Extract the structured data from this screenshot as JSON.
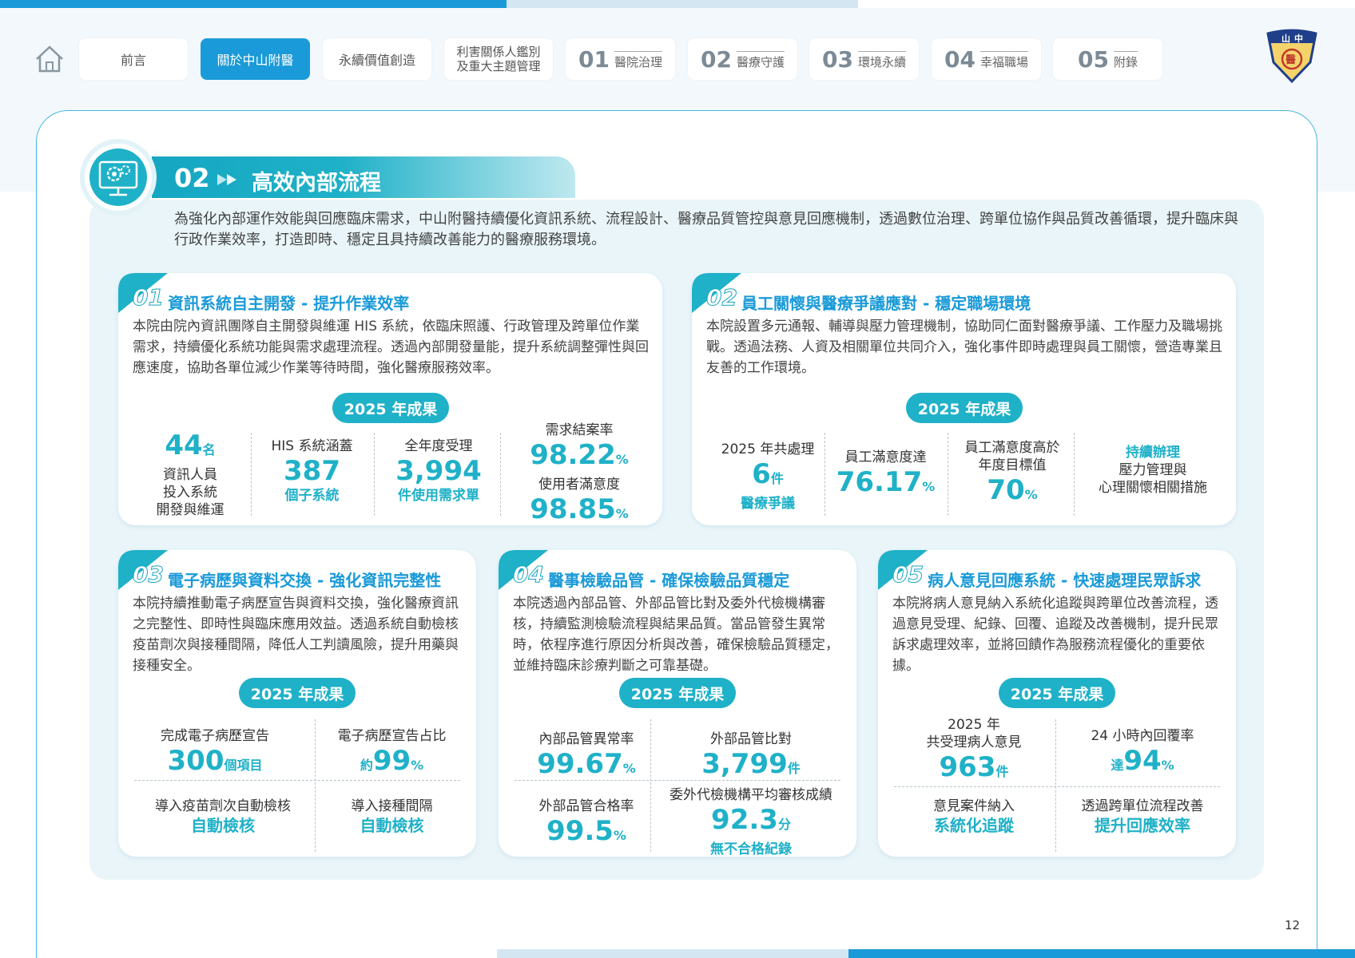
{
  "nav": {
    "tabs": [
      {
        "label": "前言"
      },
      {
        "label": "關於中山附醫"
      },
      {
        "label": "永續價值創造"
      },
      {
        "label": "利害關係人鑑別",
        "label2": "及重大主題管理"
      },
      {
        "num": "01",
        "label": "醫院治理"
      },
      {
        "num": "02",
        "label": "醫療守護"
      },
      {
        "num": "03",
        "label": "環境永續"
      },
      {
        "num": "04",
        "label": "幸福職場"
      },
      {
        "num": "05",
        "label": "附錄"
      }
    ],
    "active": "關於中山附醫",
    "logo_text": [
      "山",
      "中",
      "醫",
      "附"
    ]
  },
  "section": {
    "num": "02",
    "title": "高效內部流程",
    "intro": "為強化內部運作效能與回應臨床需求，中山附醫持續優化資訊系統、流程設計、醫療品質管控與意見回應機制，透過數位治理、跨單位協作與品質改善循環，提升臨床與行政作業效率，打造即時、穩定且具持續改善能力的醫療服務環境。"
  },
  "cards": [
    {
      "num": "01",
      "title": "資訊系統自主開發 - 提升作業效率",
      "desc": "本院由院內資訊團隊自主開發與維運 HIS 系統，依臨床照護、行政管理及跨單位作業需求，持續優化系統功能與需求處理流程。透過內部開發量能，提升系統調整彈性與回應速度，協助各單位減少作業等待時間，強化醫療服務效率。",
      "result": "2025 年成果",
      "stats": {
        "s1_big": "44",
        "s1_unit": "名",
        "s1_lab": "資訊人員",
        "s1_lab2": "投入系統",
        "s1_lab3": "開發與維運",
        "s2_lab": "HIS 系統涵蓋",
        "s2_big": "387",
        "s2_sub": "個子系統",
        "s3_lab": "全年度受理",
        "s3_big": "3,994",
        "s3_sub": "件使用需求單",
        "s4_lab": "需求結案率",
        "s4_big": "98.22",
        "s4_unit": "%",
        "s4_lab2": "使用者滿意度",
        "s4_big2": "98.85",
        "s4_unit2": "%"
      }
    },
    {
      "num": "02",
      "title": "員工關懷與醫療爭議應對 - 穩定職場環境",
      "desc": "本院設置多元通報、輔導與壓力管理機制，協助同仁面對醫療爭議、工作壓力及職場挑戰。透過法務、人資及相關單位共同介入，強化事件即時處理與員工關懷，營造專業且友善的工作環境。",
      "result": "2025 年成果",
      "stats": {
        "s1_lab": "2025 年共處理",
        "s1_big": "6",
        "s1_unit": "件",
        "s1_sub": "醫療爭議",
        "s2_lab": "員工滿意度達",
        "s2_big": "76.17",
        "s2_unit": "%",
        "s3_lab": "員工滿意度高於",
        "s3_lab2": "年度目標值",
        "s3_big": "70",
        "s3_unit": "%",
        "s4_sub": "持續辦理",
        "s4_lab": "壓力管理與",
        "s4_lab2": "心理關懷相關措施"
      }
    },
    {
      "num": "03",
      "title": "電子病歷與資料交換 - 強化資訊完整性",
      "desc": "本院持續推動電子病歷宣告與資料交換，強化醫療資訊之完整性、即時性與臨床應用效益。透過系統自動檢核疫苗劑次與接種間隔，降低人工判讀風險，提升用藥與接種安全。",
      "result": "2025 年成果",
      "stats": {
        "s1_lab": "完成電子病歷宣告",
        "s1_big": "300",
        "s1_unit": "個項目",
        "s2_lab": "電子病歷宣告占比",
        "s2_pre": "約",
        "s2_big": "99",
        "s2_unit": "%",
        "s3_lab": "導入疫苗劑次自動檢核",
        "s3_sub": "自動檢核",
        "s4_lab": "導入接種間隔",
        "s4_sub": "自動檢核"
      }
    },
    {
      "num": "04",
      "title": "醫事檢驗品管 - 確保檢驗品質穩定",
      "desc": "本院透過內部品管、外部品管比對及委外代檢機構審核，持續監測檢驗流程與結果品質。當品管發生異常時，依程序進行原因分析與改善，確保檢驗品質穩定，並維持臨床診療判斷之可靠基礎。",
      "result": "2025 年成果",
      "stats": {
        "s1_lab": "內部品管異常率",
        "s1_big": "99.67",
        "s1_unit": "%",
        "s2_lab": "外部品管比對",
        "s2_big": "3,799",
        "s2_unit": "件",
        "s3_lab": "外部品管合格率",
        "s3_big": "99.5",
        "s3_unit": "%",
        "s4_lab": "委外代檢機構平均審核成績",
        "s4_big": "92.3",
        "s4_unit": "分",
        "s4_sub": "無不合格紀錄"
      }
    },
    {
      "num": "05",
      "title": "病人意見回應系統 - 快速處理民眾訴求",
      "desc": "本院將病人意見納入系統化追蹤與跨單位改善流程，透過意見受理、紀錄、回覆、追蹤及改善機制，提升民眾訴求處理效率，並將回饋作為服務流程優化的重要依據。",
      "result": "2025 年成果",
      "stats": {
        "s1_lab": "2025 年",
        "s1_lab2": "共受理病人意見",
        "s1_big": "963",
        "s1_unit": "件",
        "s2_lab": "24 小時內回覆率",
        "s2_pre": "達",
        "s2_big": "94",
        "s2_unit": "%",
        "s3_lab": "意見案件納入",
        "s3_sub": "系統化追蹤",
        "s4_lab": "透過跨單位流程改善",
        "s4_sub": "提升回應效率"
      }
    }
  ],
  "page_number": "12",
  "colors": {
    "primary": "#1a9ad8",
    "teal": "#1fb1c8",
    "panel": "#e9f5f9"
  }
}
